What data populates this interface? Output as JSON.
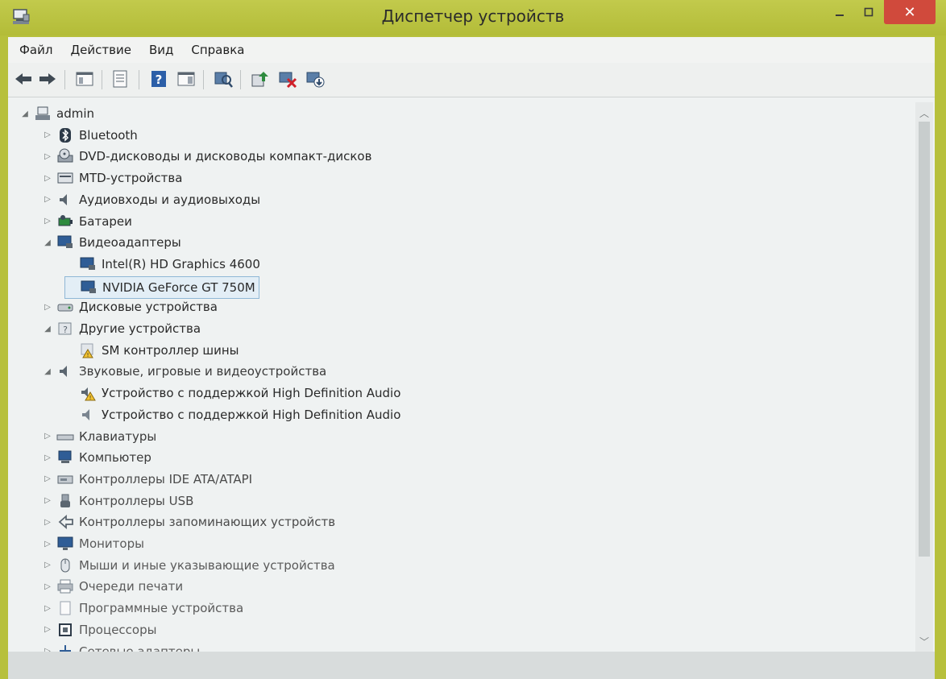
{
  "window": {
    "title": "Диспетчер устройств"
  },
  "menu": [
    "Файл",
    "Действие",
    "Вид",
    "Справка"
  ],
  "tree": {
    "root": "admin",
    "items": [
      {
        "label": "Bluetooth",
        "icon": "bluetooth-icon",
        "expanded": false,
        "children": []
      },
      {
        "label": "DVD-дисководы и дисководы компакт-дисков",
        "icon": "dvd-drive-icon",
        "expanded": false,
        "children": []
      },
      {
        "label": "MTD-устройства",
        "icon": "mtd-device-icon",
        "expanded": false,
        "children": []
      },
      {
        "label": "Аудиовходы и аудиовыходы",
        "icon": "speaker-icon",
        "expanded": false,
        "children": []
      },
      {
        "label": "Батареи",
        "icon": "battery-icon",
        "expanded": false,
        "children": []
      },
      {
        "label": "Видеоадаптеры",
        "icon": "display-adapter-icon",
        "expanded": true,
        "children": [
          "Intel(R) HD Graphics 4600",
          "NVIDIA GeForce GT 750M"
        ]
      },
      {
        "label": "Дисковые устройства",
        "icon": "disk-drive-icon",
        "expanded": false,
        "children": []
      },
      {
        "label": "Другие устройства",
        "icon": "unknown-device-icon",
        "expanded": true,
        "children": [
          "SM контроллер шины"
        ]
      },
      {
        "label": "Звуковые, игровые и видеоустройства",
        "icon": "speaker-icon",
        "expanded": true,
        "children": [
          "Устройство с поддержкой High Definition Audio",
          "Устройство с поддержкой High Definition Audio"
        ]
      },
      {
        "label": "Клавиатуры",
        "icon": "keyboard-icon",
        "expanded": false,
        "children": []
      },
      {
        "label": "Компьютер",
        "icon": "computer-icon",
        "expanded": false,
        "children": []
      },
      {
        "label": "Контроллеры IDE ATA/ATAPI",
        "icon": "ide-controller-icon",
        "expanded": false,
        "children": []
      },
      {
        "label": "Контроллеры USB",
        "icon": "usb-icon",
        "expanded": false,
        "children": []
      },
      {
        "label": "Контроллеры запоминающих устройств",
        "icon": "storage-controller-icon",
        "expanded": false,
        "children": []
      },
      {
        "label": "Мониторы",
        "icon": "monitor-icon",
        "expanded": false,
        "children": []
      },
      {
        "label": "Мыши и иные указывающие устройства",
        "icon": "mouse-icon",
        "expanded": false,
        "children": []
      },
      {
        "label": "Очереди печати",
        "icon": "printer-icon",
        "expanded": false,
        "children": []
      },
      {
        "label": "Программные устройства",
        "icon": "software-device-icon",
        "expanded": false,
        "children": []
      },
      {
        "label": "Процессоры",
        "icon": "processor-icon",
        "expanded": false,
        "children": []
      },
      {
        "label": "Сетевые адаптеры",
        "icon": "network-adapter-icon",
        "expanded": false,
        "children": []
      }
    ]
  },
  "colors": {
    "titlebar": "#b7c03c",
    "close_button": "#d04a3c",
    "selection_border": "#8fb7d6",
    "content_bg": "#eff2f2"
  }
}
